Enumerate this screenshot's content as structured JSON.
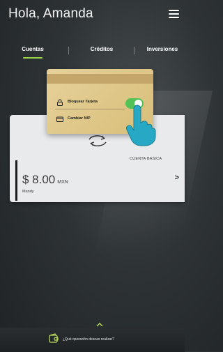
{
  "header": {
    "greeting": "Hola, Amanda",
    "menu_icon": "hamburger-menu-icon"
  },
  "tabs": [
    {
      "label": "Cuentas",
      "active": true
    },
    {
      "label": "Créditos",
      "active": false
    },
    {
      "label": "Inversiones",
      "active": false
    }
  ],
  "card_menu": {
    "items": [
      {
        "label": "Bloquear Tarjeta",
        "icon": "lock-icon"
      },
      {
        "label": "Cambiar NIP",
        "icon": "card-icon"
      }
    ],
    "toggle_on": true
  },
  "account": {
    "type": "CUENTA BASICA",
    "amount": "$ 8.00",
    "currency": "MXN",
    "holder": "Mandy"
  },
  "bottom": {
    "prompt": "¿Qué operación deseas realizar?"
  },
  "colors": {
    "accent": "#9bd34a",
    "toggle": "#52c257",
    "gold": "#e0c98a"
  }
}
